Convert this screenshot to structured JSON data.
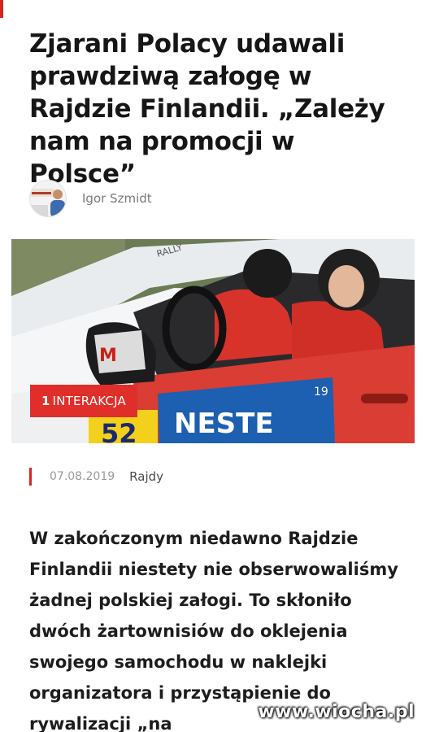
{
  "article": {
    "headline": "Zjarani Polacy udawali prawdziwą załogę w Rajdzie Finlandii. „Zależy nam na promocji w Polsce”",
    "author_name": "Igor Szmidt",
    "hero": {
      "car_sponsor_text": "NESTE",
      "car_sticker_number": "19",
      "car_number": "52",
      "banner_text": "RALLY"
    },
    "interactions_badge": {
      "count": "1",
      "label": "INTERAKCJA"
    },
    "date": "07.08.2019",
    "category": "Rajdy",
    "lead": "W zakończonym niedawno Rajdzie Finlandii niestety nie obserwowaliśmy żadnej polskiej załogi. To skłoniło dwóch żartownisiów do oklejenia swojego samochodu w naklejki organizatora i przystąpienie do rywalizacji „na"
  },
  "watermark": "www.wiocha.pl",
  "colors": {
    "accent": "#d7261e",
    "badge": "#e02f2a",
    "text": "#161616",
    "muted": "#9a9a9a"
  }
}
